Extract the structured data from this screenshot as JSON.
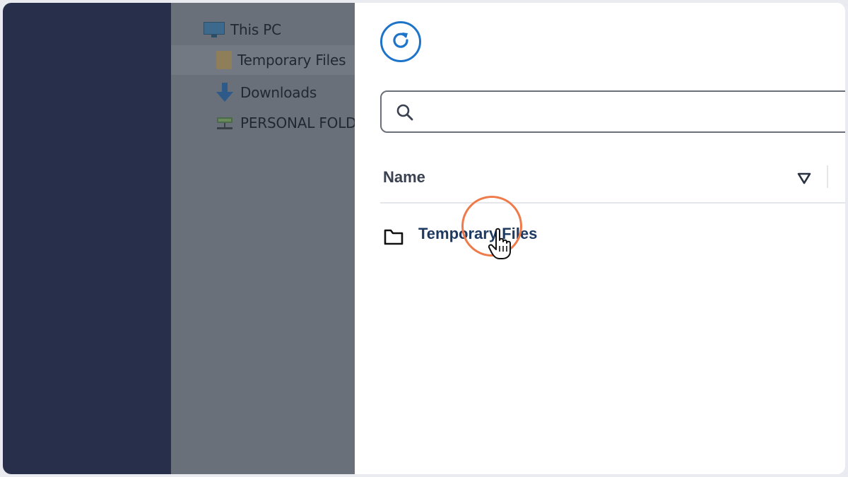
{
  "explorer": {
    "items": [
      {
        "label": "This PC",
        "icon": "computer-icon"
      },
      {
        "label": "Temporary Files",
        "icon": "folder-icon",
        "selected": true
      },
      {
        "label": "Downloads",
        "icon": "download-arrow-icon"
      },
      {
        "label": "PERSONAL FOLD",
        "icon": "network-drive-icon"
      }
    ]
  },
  "toolbar": {
    "refresh_icon": "refresh-icon"
  },
  "search": {
    "placeholder": "",
    "value": ""
  },
  "table": {
    "columns": [
      {
        "label": "Name",
        "sort_icon": "sort-down-icon"
      }
    ],
    "rows": [
      {
        "name": "Temporary Files",
        "icon": "folder-outline-icon"
      }
    ]
  },
  "colors": {
    "accent": "#1e74c9",
    "highlight_ring": "#ef7a4a",
    "sidebar_dark": "#272f4a",
    "overlay": "#6a707a",
    "link_text": "#1f3a60"
  }
}
